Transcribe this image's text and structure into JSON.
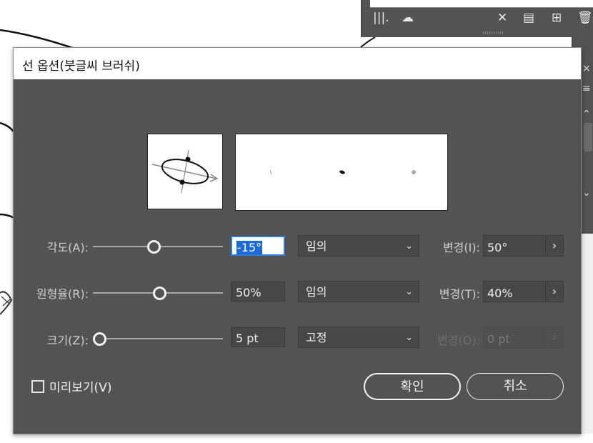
{
  "dialog": {
    "title": "선 옵션(붓글씨 브러쉬)",
    "rows": [
      {
        "label": "각도(A):",
        "slider_value_fraction": 0.46,
        "field_value": "-15°",
        "method": "임의",
        "variation_label": "변경(I):",
        "variation_value": "50°",
        "variation_enabled": true
      },
      {
        "label": "원형율(R):",
        "slider_value_fraction": 0.5,
        "field_value": "50%",
        "method": "임의",
        "variation_label": "변경(T):",
        "variation_value": "40%",
        "variation_enabled": true
      },
      {
        "label": "크기(Z):",
        "slider_value_fraction": 0.0,
        "field_value": "5 pt",
        "method": "고정",
        "variation_label": "변경(O):",
        "variation_value": "0 pt",
        "variation_enabled": false
      }
    ],
    "preview_checkbox_label": "미리보기(V)",
    "preview_checked": false,
    "ok_label": "확인",
    "cancel_label": "취소",
    "arrow_glyph": "›",
    "chevron_glyph": "⌄"
  },
  "panel": {
    "icons": [
      "libraries-icon",
      "creative-cloud-icon",
      "remove-brush-icon",
      "brush-options-icon",
      "new-brush-icon",
      "trash-icon"
    ]
  },
  "colors": {
    "dialog_bg": "#535353",
    "field_bg": "#474747",
    "focus_blue": "#2d7be4"
  }
}
